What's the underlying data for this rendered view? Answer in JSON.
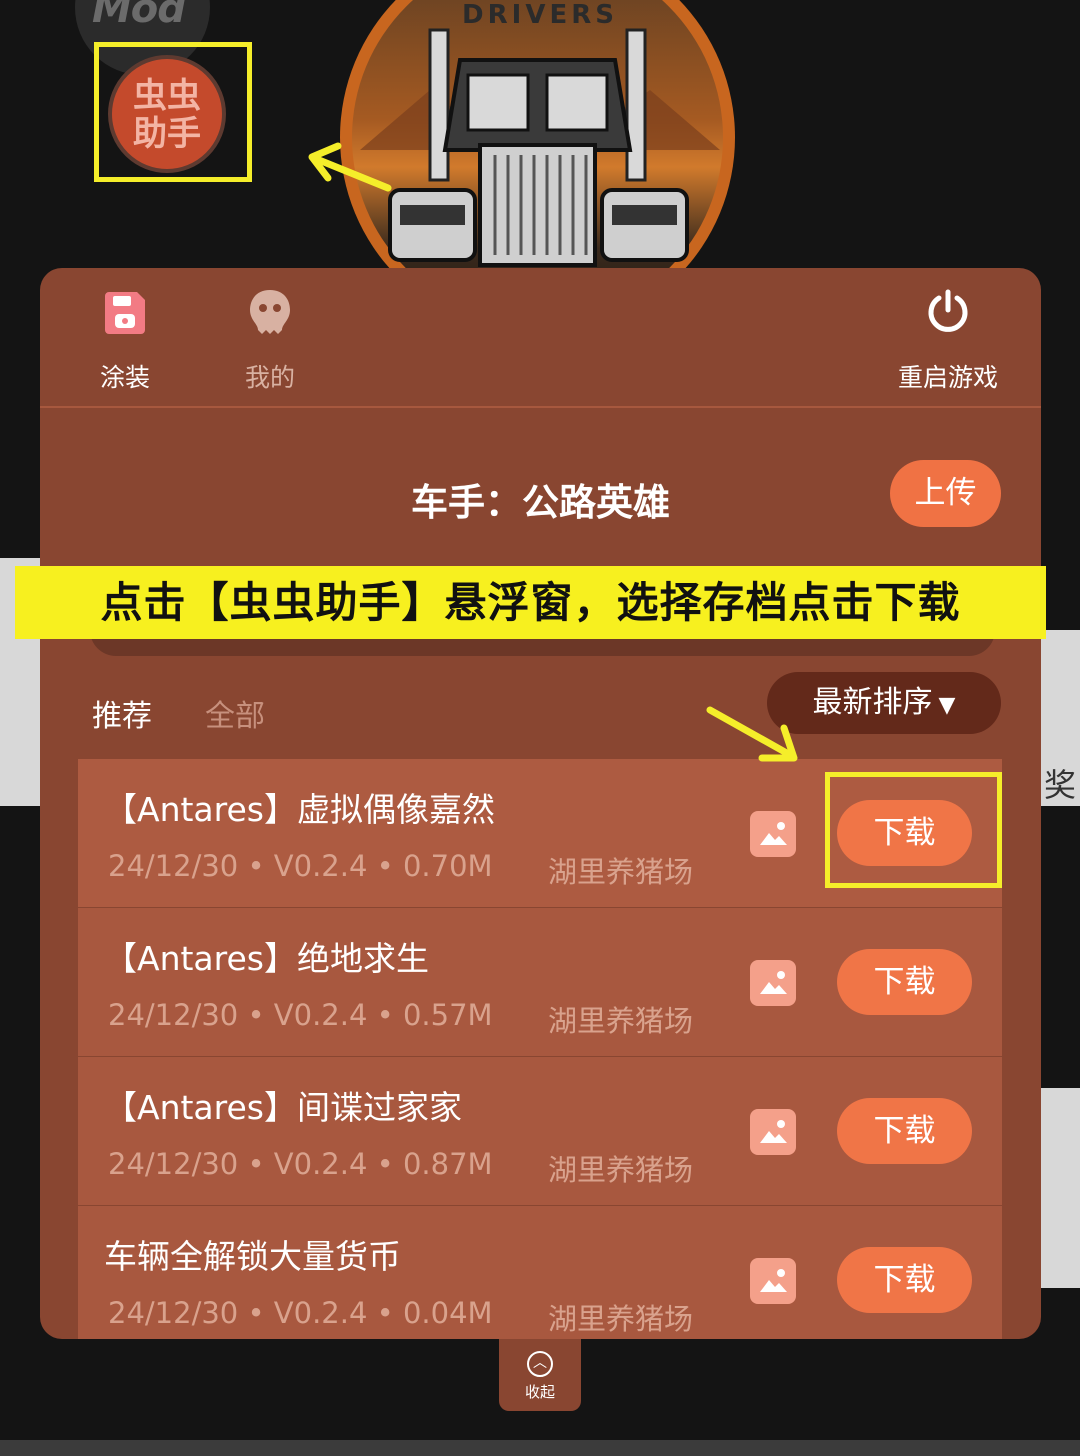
{
  "background": {
    "mod_text": "Mod",
    "logo_word": "DRIVERS"
  },
  "assistant_bubble": {
    "label_line1": "虫虫",
    "label_line2": "助手"
  },
  "tabs": [
    {
      "label": "涂装",
      "icon": "save-icon",
      "active": true
    },
    {
      "label": "我的",
      "icon": "profile-icon",
      "active": false
    }
  ],
  "restart": {
    "label": "重启游戏",
    "icon": "power-icon"
  },
  "car_title": "车手：公路英雄",
  "upload_label": "上传",
  "annotation_banner": "点击【虫虫助手】悬浮窗，选择存档点击下载",
  "filters": {
    "recommended": "推荐",
    "all": "全部",
    "sort_label": "最新排序"
  },
  "saves": [
    {
      "title": "【Antares】虚拟偶像嘉然",
      "meta": "24/12/30 • V0.2.4 • 0.70M",
      "author": "湖里养猪场",
      "download_label": "下载"
    },
    {
      "title": "【Antares】绝地求生",
      "meta": "24/12/30 • V0.2.4 • 0.57M",
      "author": "湖里养猪场",
      "download_label": "下载"
    },
    {
      "title": "【Antares】间谍过家家",
      "meta": "24/12/30 • V0.2.4 • 0.87M",
      "author": "湖里养猪场",
      "download_label": "下载"
    },
    {
      "title": "车辆全解锁大量货币",
      "meta": "24/12/30 • V0.2.4 • 0.04M",
      "author": "湖里养猪场",
      "download_label": "下载"
    }
  ],
  "collapse_label": "收起",
  "side_text": "奖",
  "colors": {
    "panel": "#894631",
    "accent": "#f07547",
    "highlight": "#f5ee2a"
  }
}
